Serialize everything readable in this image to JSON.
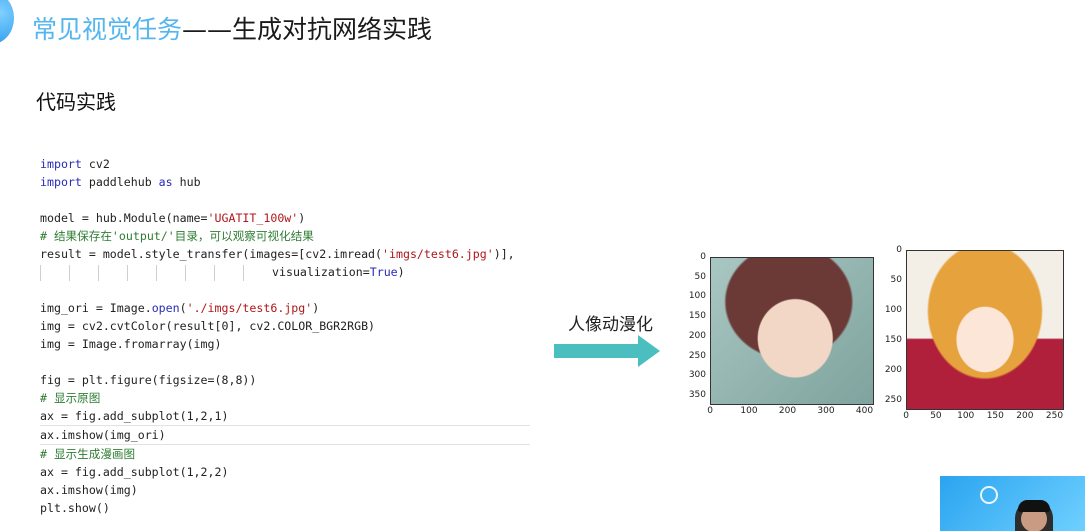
{
  "header": {
    "title_part1": "常见视觉任务",
    "title_part2": "——生成对抗网络实践"
  },
  "section": {
    "subtitle": "代码实践"
  },
  "code_lines": [
    [
      {
        "t": "import",
        "c": "kw"
      },
      {
        "t": " cv2",
        "c": ""
      }
    ],
    [
      {
        "t": "import",
        "c": "kw"
      },
      {
        "t": " paddlehub ",
        "c": ""
      },
      {
        "t": "as",
        "c": "kw"
      },
      {
        "t": " hub",
        "c": ""
      }
    ],
    [],
    [
      {
        "t": "model = hub.Module(name=",
        "c": ""
      },
      {
        "t": "'UGATIT_100w'",
        "c": "str"
      },
      {
        "t": ")",
        "c": ""
      }
    ],
    [
      {
        "t": "# 结果保存在'output/'目录，可以观察可视化结果",
        "c": "cmt"
      }
    ],
    [
      {
        "t": "result = model.style_transfer(images=[cv2.imread(",
        "c": ""
      },
      {
        "t": "'imgs/test6.jpg'",
        "c": "str"
      },
      {
        "t": ")],",
        "c": ""
      }
    ],
    [
      {
        "t": "                              visualization=",
        "c": ""
      },
      {
        "t": "True",
        "c": "kw"
      },
      {
        "t": ")",
        "c": ""
      }
    ],
    [],
    [
      {
        "t": "img_ori = Image.",
        "c": ""
      },
      {
        "t": "open",
        "c": "kw"
      },
      {
        "t": "(",
        "c": ""
      },
      {
        "t": "'./imgs/test6.jpg'",
        "c": "str"
      },
      {
        "t": ")",
        "c": ""
      }
    ],
    [
      {
        "t": "img = cv2.cvtColor(result[0], cv2.COLOR_BGR2RGB)",
        "c": ""
      }
    ],
    [
      {
        "t": "img = Image.fromarray(img)",
        "c": ""
      }
    ],
    [],
    [
      {
        "t": "fig = plt.figure(figsize=(8,8))",
        "c": ""
      }
    ],
    [
      {
        "t": "# 显示原图",
        "c": "cmt"
      }
    ],
    [
      {
        "t": "ax = fig.add_subplot(1,2,1)",
        "c": ""
      }
    ],
    [
      {
        "t": "ax.imshow(img_ori)",
        "c": ""
      }
    ],
    [
      {
        "t": "# 显示生成漫画图",
        "c": "cmt"
      }
    ],
    [
      {
        "t": "ax = fig.add_subplot(1,2,2)",
        "c": ""
      }
    ],
    [
      {
        "t": "ax.imshow(img)",
        "c": ""
      }
    ],
    [
      {
        "t": "plt.show()",
        "c": ""
      }
    ]
  ],
  "arrow": {
    "label": "人像动漫化",
    "color": "#4bbfc0"
  },
  "plots": [
    {
      "y_ticks": [
        "0",
        "50",
        "100",
        "150",
        "200",
        "250",
        "300",
        "350"
      ],
      "x_ticks": [
        "0",
        "100",
        "200",
        "300",
        "400"
      ]
    },
    {
      "y_ticks": [
        "0",
        "50",
        "100",
        "150",
        "200",
        "250"
      ],
      "x_ticks": [
        "0",
        "50",
        "100",
        "150",
        "200",
        "250"
      ]
    }
  ]
}
